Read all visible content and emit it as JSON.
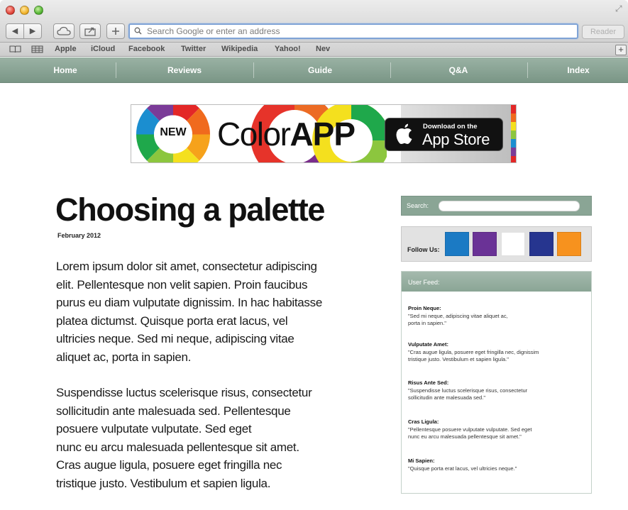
{
  "browser": {
    "back_label": "◀",
    "forward_label": "▶",
    "address_placeholder": "Search Google or enter an address",
    "reader_label": "Reader",
    "bookmarks": [
      "Apple",
      "iCloud",
      "Facebook",
      "Twitter",
      "Wikipedia",
      "Yahoo!",
      "Nev"
    ],
    "add_bookmark_label": "+"
  },
  "site": {
    "nav": [
      "Home",
      "Reviews",
      "Guide",
      "Q&A",
      "Index"
    ],
    "nav_color": "#86a192",
    "banner": {
      "new_label": "NEW",
      "app_name_light": "Color",
      "app_name_bold": "APP",
      "badge_small": "Download on the",
      "badge_big": "App Store"
    },
    "article": {
      "title": "Choosing a palette",
      "date": "February 2012",
      "paragraph1_lines": [
        "Lorem ipsum dolor sit amet, consectetur adipiscing",
        "elit. Pellentesque non velit sapien. Proin faucibus",
        "purus eu diam vulputate dignissim. In hac habitasse",
        "platea dictumst. Quisque porta erat lacus, vel",
        "ultricies neque. Sed mi neque, adipiscing vitae",
        "aliquet ac, porta in sapien."
      ],
      "paragraph2_lines": [
        "Suspendisse luctus scelerisque risus, consectetur",
        "sollicitudin ante malesuada sed. Pellentesque",
        "posuere vulputate vulputate. Sed eget",
        "nunc eu arcu malesuada pellentesque sit amet.",
        "Cras augue ligula, posuere eget fringilla nec",
        "tristique justo. Vestibulum et sapien ligula."
      ]
    },
    "sidebar": {
      "search_label": "Search:",
      "follow_label": "Follow Us:",
      "follow_colors": [
        "#1b7ac4",
        "#6a3296",
        "#ffffff",
        "#26358f",
        "#f7921e"
      ],
      "feed_title": "User Feed:",
      "feed": [
        {
          "name": "Proin Neque:",
          "quote_lines": [
            "\"Sed mi neque, adipiscing vitae aliquet ac,",
            "porta in sapien.\""
          ]
        },
        {
          "name": "Vulputate Amet:",
          "quote_lines": [
            "\"Cras augue ligula, posuere eget fringilla nec, dignissim",
            "tristique justo. Vestibulum et sapien ligula.\""
          ]
        },
        {
          "name": "Risus Ante Sed:",
          "quote_lines": [
            "\"Suspendisse luctus scelerisque risus, consectetur",
            "sollicitudin ante malesuada sed.\""
          ]
        },
        {
          "name": "Cras Ligula:",
          "quote_lines": [
            "\"Pellentesque posuere vulputate vulputate. Sed eget",
            "nunc eu arcu malesuada pellentesque sit amet.\""
          ]
        },
        {
          "name": "Mi Sapien:",
          "quote_lines": [
            "\"Quisque porta erat lacus, vel ultricies neque.\""
          ]
        }
      ]
    }
  }
}
